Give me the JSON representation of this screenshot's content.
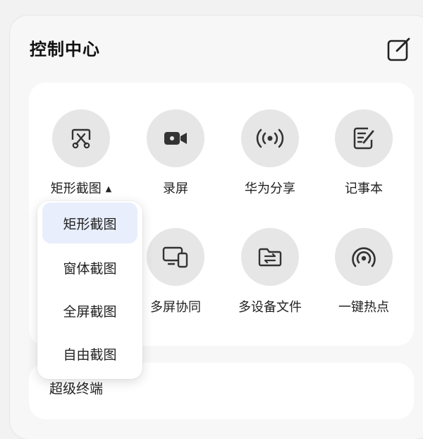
{
  "header": {
    "title": "控制中心",
    "edit_icon": "edit-square-icon"
  },
  "tiles": [
    {
      "label": "矩形截图",
      "icon": "screenshot-crop-icon",
      "has_dropdown": true
    },
    {
      "label": "录屏",
      "icon": "video-camera-icon"
    },
    {
      "label": "华为分享",
      "icon": "share-broadcast-icon"
    },
    {
      "label": "记事本",
      "icon": "notepad-icon"
    },
    {
      "label": "多屏协同",
      "icon": "multi-screen-icon"
    },
    {
      "label": "多设备文件",
      "icon": "folder-transfer-icon"
    },
    {
      "label": "一键热点",
      "icon": "hotspot-icon"
    }
  ],
  "dropdown": {
    "items": [
      "矩形截图",
      "窗体截图",
      "全屏截图",
      "自由截图"
    ],
    "selected_index": 0
  },
  "second_card": {
    "label": "超级终端"
  },
  "colors": {
    "panel_bg": "#f7f7f7",
    "circle_bg": "#e6e6e6",
    "selected_bg": "#e8eefb"
  }
}
